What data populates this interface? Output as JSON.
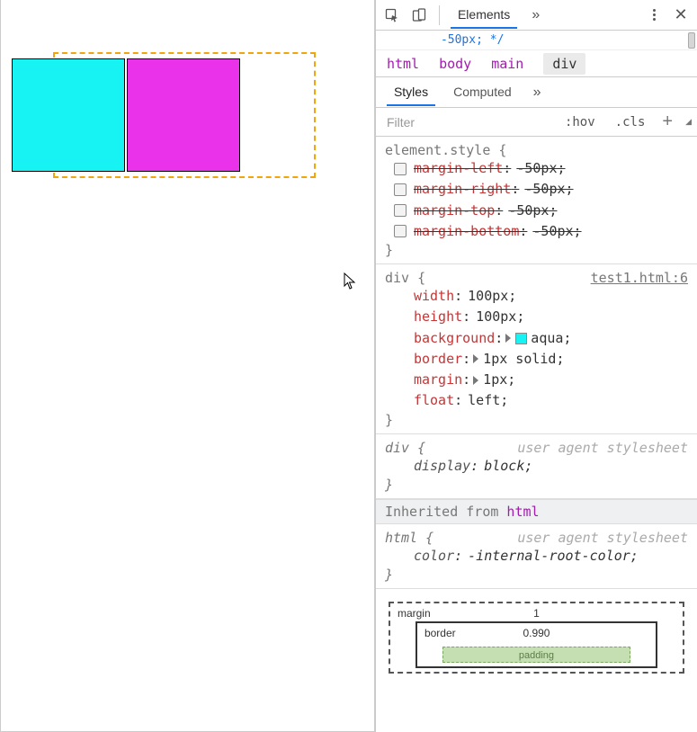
{
  "peek_text": "-50px; */",
  "toolbar": {
    "elements_tab": "Elements",
    "more_tabs_glyph": "»"
  },
  "breadcrumbs": [
    "html",
    "body",
    "main",
    "div"
  ],
  "sub_tabs": {
    "styles": "Styles",
    "computed": "Computed",
    "more_glyph": "»"
  },
  "filter": {
    "placeholder": "Filter",
    "hov": ":hov",
    "cls": ".cls"
  },
  "element_style": {
    "selector": "element.style",
    "props": [
      {
        "name": "margin-left",
        "value": "-50px"
      },
      {
        "name": "margin-right",
        "value": "-50px"
      },
      {
        "name": "margin-top",
        "value": "-50px"
      },
      {
        "name": "margin-bottom",
        "value": "-50px"
      }
    ]
  },
  "rule1": {
    "selector": "div",
    "source": "test1.html:6",
    "props": {
      "width": {
        "name": "width",
        "value": "100px"
      },
      "height": {
        "name": "height",
        "value": "100px"
      },
      "background": {
        "name": "background",
        "value": "aqua",
        "swatch": "#17f3f3"
      },
      "border": {
        "name": "border",
        "value": "1px solid"
      },
      "margin": {
        "name": "margin",
        "value": "1px"
      },
      "float": {
        "name": "float",
        "value": "left"
      }
    }
  },
  "rule2_ua": {
    "selector": "div",
    "sheet": "user agent stylesheet",
    "display": {
      "name": "display",
      "value": "block"
    }
  },
  "inherited_label": "Inherited from",
  "inherited_from": "html",
  "rule3_ua": {
    "selector": "html",
    "sheet": "user agent stylesheet",
    "color": {
      "name": "color",
      "value": "-internal-root-color"
    }
  },
  "boxmodel": {
    "margin_label": "margin",
    "margin_top": "1",
    "border_label": "border",
    "border_top": "0.990",
    "padding_label": "padding"
  }
}
